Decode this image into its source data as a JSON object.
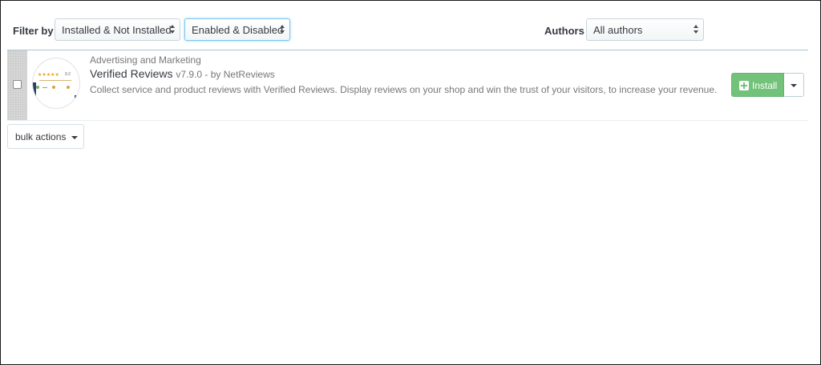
{
  "filters": {
    "filter_by_label": "Filter by",
    "install_status": "Installed & Not Installed",
    "enabled_status": "Enabled & Disabled",
    "authors_label": "Authors",
    "authors_value": "All authors"
  },
  "module": {
    "category": "Advertising and Marketing",
    "name": "Verified Reviews",
    "version_author": "v7.9.0 - by NetReviews",
    "description": "Collect service and product reviews with Verified Reviews. Display reviews on your shop and win the trust of your visitors, to increase your revenue.",
    "logo_stars": "★★★★★",
    "logo_score": "9.2",
    "install_label": "Install",
    "checked": false
  },
  "bulk": {
    "label": "bulk actions"
  },
  "colors": {
    "install_green": "#72c279",
    "row_border": "#a7c6d3",
    "focus_blue": "#7cc6ee"
  },
  "icons": [
    "plus-square-icon",
    "caret-down-icon",
    "select-arrows-icon"
  ]
}
